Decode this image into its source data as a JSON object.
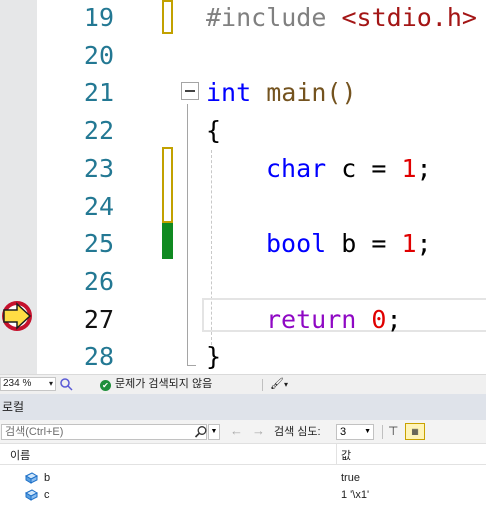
{
  "editor": {
    "lines": [
      {
        "num": "19"
      },
      {
        "num": "20"
      },
      {
        "num": "21"
      },
      {
        "num": "22"
      },
      {
        "num": "23"
      },
      {
        "num": "24"
      },
      {
        "num": "25"
      },
      {
        "num": "26"
      },
      {
        "num": "27"
      },
      {
        "num": "28"
      }
    ],
    "code": {
      "include_directive": "#include",
      "include_header": "<stdio.h>",
      "int_kw": "int",
      "main_sig": "main()",
      "open_brace": "{",
      "char_kw": "char",
      "char_decl": " c = ",
      "char_val": "1",
      "semicolon": ";",
      "bool_kw": "bool",
      "bool_decl": " b = ",
      "bool_val": "1",
      "return_kw": "return",
      "return_val": "0",
      "close_brace": "}"
    }
  },
  "status_bar": {
    "zoom": "234 %",
    "issues_text": "문제가 검색되지 않음"
  },
  "locals": {
    "title": "로컬",
    "search_placeholder": "검색(Ctrl+E)",
    "depth_label": "검색 심도:",
    "depth_value": "3",
    "columns": {
      "name": "이름",
      "value": "값"
    },
    "rows": [
      {
        "name": "b",
        "value": "true"
      },
      {
        "name": "c",
        "value": "1 '\\x1'"
      }
    ]
  },
  "colors": {
    "keyword": "#0000ff",
    "string": "#a31515",
    "number": "#e00000",
    "control": "#8f08c4",
    "line_number": "#237893"
  }
}
